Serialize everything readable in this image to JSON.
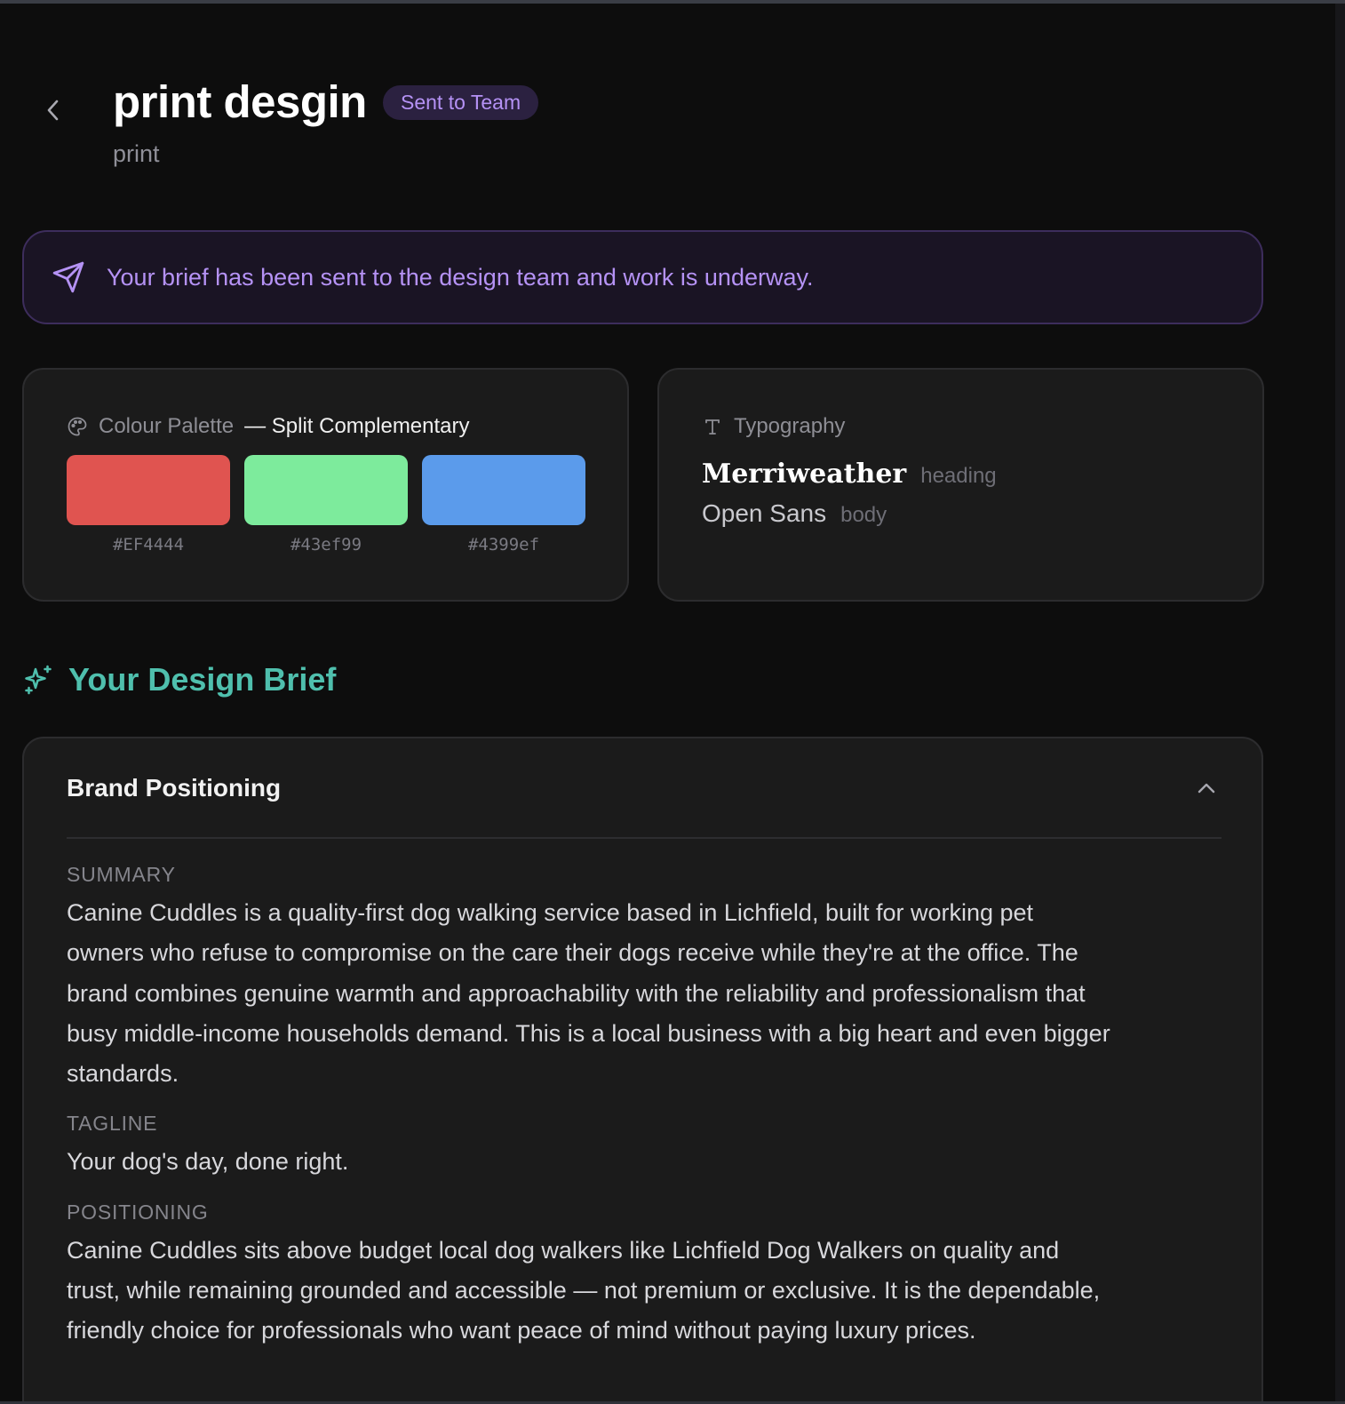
{
  "header": {
    "title": "print desgin",
    "status": "Sent to Team",
    "subtitle": "print",
    "back_icon": "chevron-left-icon"
  },
  "banner": {
    "icon": "send-icon",
    "message": "Your brief has been sent to the design team and work is underway."
  },
  "palette": {
    "icon": "palette-icon",
    "label": "Colour Palette",
    "scheme": "— Split Complementary",
    "colors": [
      {
        "hex": "#EF4444",
        "display": "#E05450"
      },
      {
        "hex": "#43ef99",
        "display": "#7DEB9C"
      },
      {
        "hex": "#4399ef",
        "display": "#5B9BEB"
      }
    ]
  },
  "typography": {
    "icon": "type-icon",
    "label": "Typography",
    "heading_font": "Merriweather",
    "heading_role": "heading",
    "body_font": "Open Sans",
    "body_role": "body"
  },
  "brief": {
    "icon": "sparkles-icon",
    "title": "Your Design Brief",
    "section": {
      "title": "Brand Positioning",
      "toggle_icon": "chevron-up-icon",
      "fields": [
        {
          "label": "SUMMARY",
          "lines": [
            "Canine Cuddles is a quality-first dog walking service based in Lichfield, built for working pet",
            "owners who refuse to compromise on the care their dogs receive while they're at the office. The",
            "brand combines genuine warmth and approachability with the reliability and professionalism that",
            "busy middle-income households demand. This is a local business with a big heart and even bigger",
            "standards."
          ]
        },
        {
          "label": "TAGLINE",
          "lines": [
            "Your dog's day, done right."
          ]
        },
        {
          "label": "POSITIONING",
          "lines": [
            "Canine Cuddles sits above budget local dog walkers like Lichfield Dog Walkers on quality and",
            "trust, while remaining grounded and accessible — not premium or exclusive. It is the dependable,",
            "friendly choice for professionals who want peace of mind without paying luxury prices."
          ]
        }
      ]
    }
  },
  "colors": {
    "background": "#0d0d0d",
    "card": "#1b1b1b",
    "accent_purple": "#b592f5",
    "accent_teal": "#4fbfad"
  }
}
